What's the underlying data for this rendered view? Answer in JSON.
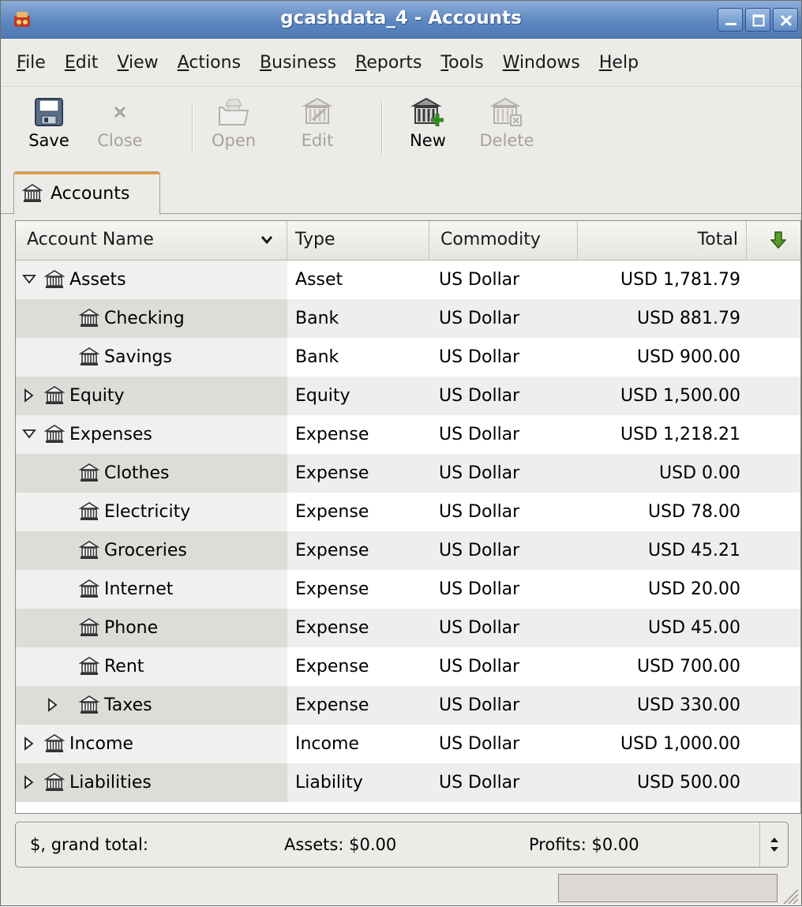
{
  "window": {
    "title": "gcashdata_4 - Accounts",
    "accent_color": "#5d87c0"
  },
  "menu": [
    {
      "mnemonic": "F",
      "rest": "ile"
    },
    {
      "mnemonic": "E",
      "rest": "dit"
    },
    {
      "mnemonic": "V",
      "rest": "iew"
    },
    {
      "mnemonic": "A",
      "rest": "ctions"
    },
    {
      "mnemonic": "B",
      "rest": "usiness"
    },
    {
      "mnemonic": "R",
      "rest": "eports"
    },
    {
      "mnemonic": "T",
      "rest": "ools"
    },
    {
      "mnemonic": "W",
      "rest": "indows"
    },
    {
      "mnemonic": "H",
      "rest": "elp"
    }
  ],
  "toolbar": {
    "save": "Save",
    "close": "Close",
    "open": "Open",
    "edit": "Edit",
    "new": "New",
    "delete": "Delete"
  },
  "tab": {
    "label": "Accounts"
  },
  "columns": {
    "name": "Account Name",
    "type": "Type",
    "commodity": "Commodity",
    "total": "Total"
  },
  "accounts": [
    {
      "name": "Assets",
      "type": "Asset",
      "commodity": "US Dollar",
      "total": "USD 1,781.79",
      "depth": 0,
      "expander": "expanded"
    },
    {
      "name": "Checking",
      "type": "Bank",
      "commodity": "US Dollar",
      "total": "USD 881.79",
      "depth": 1,
      "expander": "none"
    },
    {
      "name": "Savings",
      "type": "Bank",
      "commodity": "US Dollar",
      "total": "USD 900.00",
      "depth": 1,
      "expander": "none"
    },
    {
      "name": "Equity",
      "type": "Equity",
      "commodity": "US Dollar",
      "total": "USD 1,500.00",
      "depth": 0,
      "expander": "collapsed"
    },
    {
      "name": "Expenses",
      "type": "Expense",
      "commodity": "US Dollar",
      "total": "USD 1,218.21",
      "depth": 0,
      "expander": "expanded"
    },
    {
      "name": "Clothes",
      "type": "Expense",
      "commodity": "US Dollar",
      "total": "USD 0.00",
      "depth": 1,
      "expander": "none"
    },
    {
      "name": "Electricity",
      "type": "Expense",
      "commodity": "US Dollar",
      "total": "USD 78.00",
      "depth": 1,
      "expander": "none"
    },
    {
      "name": "Groceries",
      "type": "Expense",
      "commodity": "US Dollar",
      "total": "USD 45.21",
      "depth": 1,
      "expander": "none"
    },
    {
      "name": "Internet",
      "type": "Expense",
      "commodity": "US Dollar",
      "total": "USD 20.00",
      "depth": 1,
      "expander": "none"
    },
    {
      "name": "Phone",
      "type": "Expense",
      "commodity": "US Dollar",
      "total": "USD 45.00",
      "depth": 1,
      "expander": "none"
    },
    {
      "name": "Rent",
      "type": "Expense",
      "commodity": "US Dollar",
      "total": "USD 700.00",
      "depth": 1,
      "expander": "none"
    },
    {
      "name": "Taxes",
      "type": "Expense",
      "commodity": "US Dollar",
      "total": "USD 330.00",
      "depth": 1,
      "expander": "collapsed"
    },
    {
      "name": "Income",
      "type": "Income",
      "commodity": "US Dollar",
      "total": "USD 1,000.00",
      "depth": 0,
      "expander": "collapsed"
    },
    {
      "name": "Liabilities",
      "type": "Liability",
      "commodity": "US Dollar",
      "total": "USD 500.00",
      "depth": 0,
      "expander": "collapsed"
    }
  ],
  "summary": {
    "label": "$, grand total:",
    "assets": "Assets: $0.00",
    "profits": "Profits: $0.00"
  }
}
